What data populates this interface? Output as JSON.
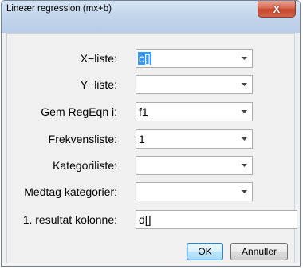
{
  "window": {
    "title": "Lineær regression (mx+b)",
    "close_glyph": "X"
  },
  "fields": [
    {
      "label": "X−liste:",
      "value": "c[]",
      "selected": true,
      "kind": "combo"
    },
    {
      "label": "Y−liste:",
      "value": "",
      "kind": "combo"
    },
    {
      "label": "Gem RegEqn i:",
      "value": "f1",
      "kind": "combo"
    },
    {
      "label": "Frekvensliste:",
      "value": "1",
      "kind": "combo"
    },
    {
      "label": "Kategoriliste:",
      "value": "",
      "kind": "combo"
    },
    {
      "label": "Medtag kategorier:",
      "value": "",
      "kind": "combo"
    },
    {
      "label": "1. resultat kolonne:",
      "value": "d[]",
      "kind": "text"
    }
  ],
  "buttons": {
    "ok": "OK",
    "cancel": "Annuller"
  },
  "colors": {
    "selection": "#3399ff",
    "title_bar": "#c3d6ec",
    "close_button": "#c6462a"
  },
  "icons": {
    "combo_arrow": "chevron-down-icon",
    "close": "close-icon"
  }
}
